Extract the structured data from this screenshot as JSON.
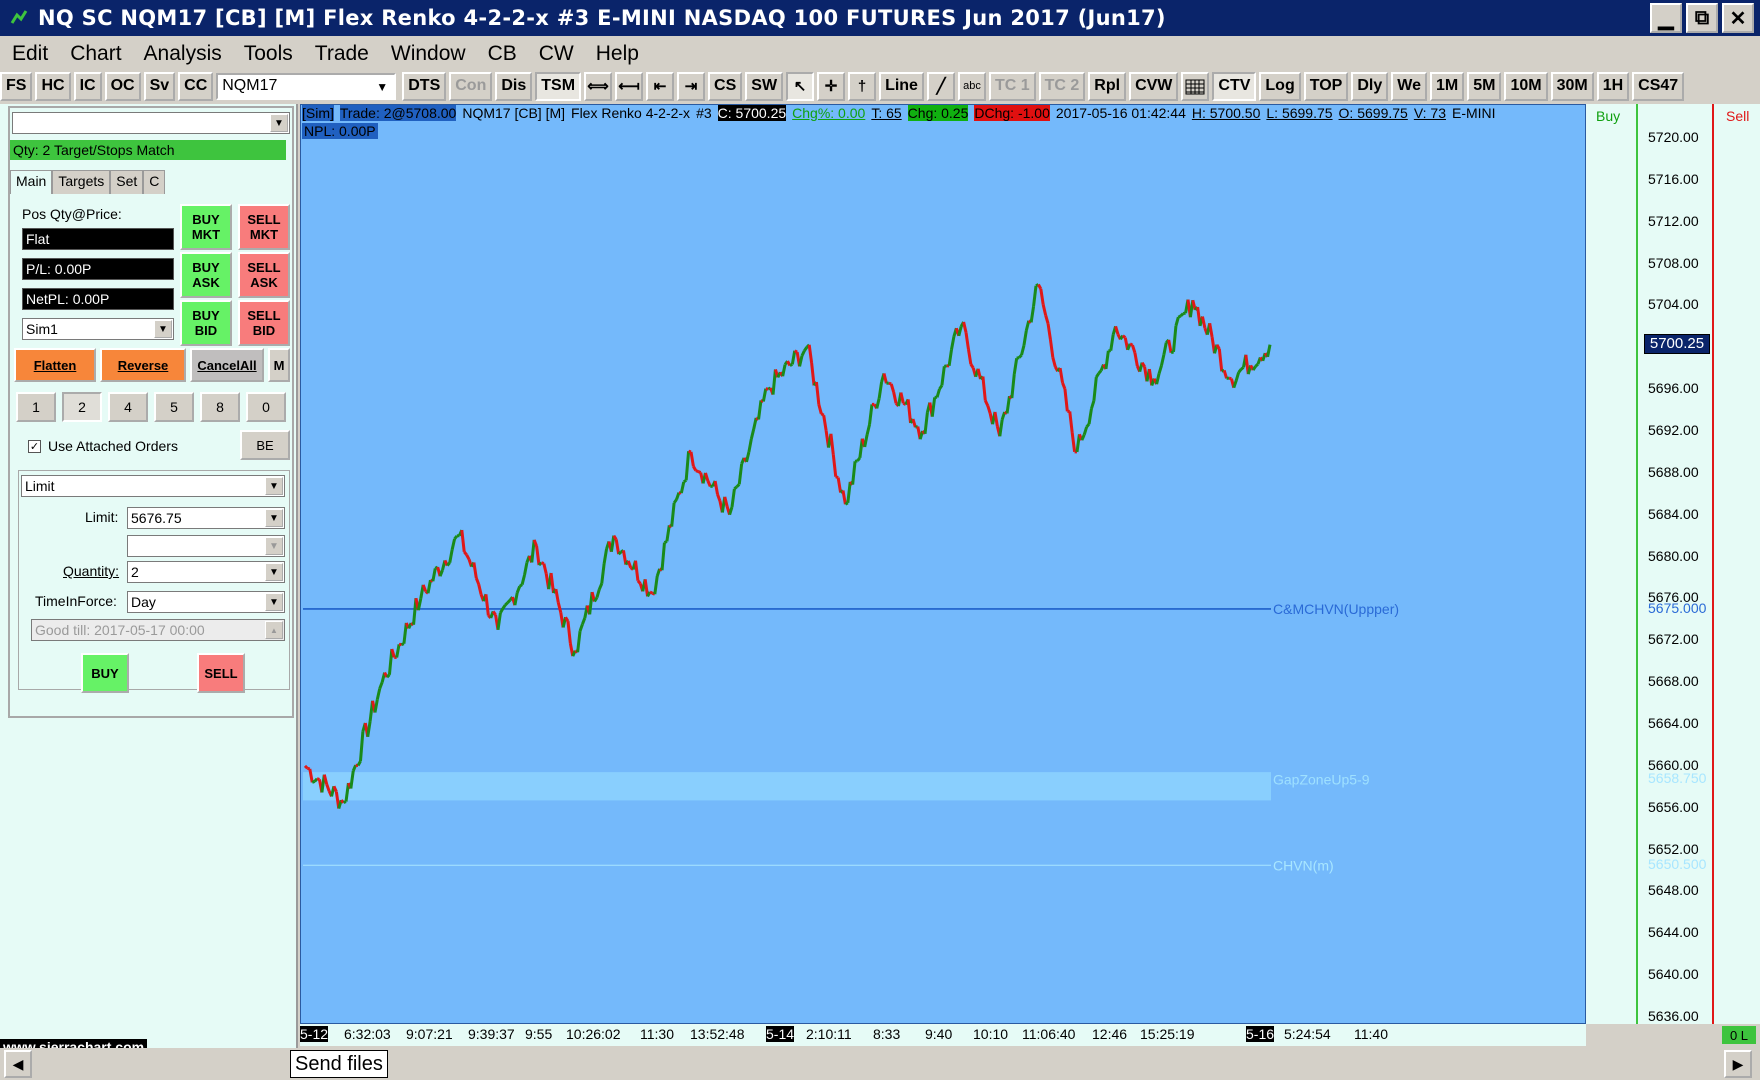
{
  "window": {
    "title": "NQ  SC NQM17 [CB] [M]  Flex Renko 4-2-2-x  #3  E-MINI NASDAQ 100 FUTURES Jun 2017 (Jun17)",
    "min_label": "▁",
    "max_label": "⧉",
    "close_label": "✕"
  },
  "menu": [
    "Edit",
    "Chart",
    "Analysis",
    "Tools",
    "Trade",
    "Window",
    "CB",
    "CW",
    "Help"
  ],
  "toolbar": {
    "left_buttons": [
      "FS",
      "HC",
      "IC",
      "OC",
      "Sv",
      "CC"
    ],
    "symbol": "NQM17",
    "buttons": [
      "DTS",
      "Con",
      "Dis",
      "TSM"
    ],
    "icon_buttons": [
      "⟺",
      "⟻",
      "⇤",
      "⇥"
    ],
    "buttons2": [
      "CS",
      "SW"
    ],
    "tool_icons": [
      "↖",
      "✛",
      "†"
    ],
    "buttons3": [
      "Line"
    ],
    "tool_icons2": [
      "╱",
      "abc"
    ],
    "buttons4": [
      "TC 1",
      "TC 2",
      "Rpl",
      "CVW"
    ],
    "buttons5": [
      "CTV",
      "Log",
      "TOP",
      "Dly",
      "We",
      "1M",
      "5M",
      "10M",
      "30M",
      "1H",
      "CS47"
    ]
  },
  "trade_panel": {
    "top_combo_value": "",
    "status": "Qty: 2 Target/Stops Match",
    "tabs": [
      "Main",
      "Targets",
      "Set",
      "C"
    ],
    "pos_label": "Pos Qty@Price:",
    "pos_value": "Flat",
    "pl_value": "P/L: 0.00P",
    "netpl_value": "NetPL: 0.00P",
    "account": "Sim1",
    "buy_mkt": "BUY MKT",
    "sell_mkt": "SELL MKT",
    "buy_ask": "BUY ASK",
    "sell_ask": "SELL ASK",
    "buy_bid": "BUY BID",
    "sell_bid": "SELL BID",
    "flatten": "Flatten",
    "reverse": "Reverse",
    "cancel_all": "CancelAll",
    "m_button": "M",
    "qty_buttons": [
      "1",
      "2",
      "4",
      "5",
      "8",
      "0"
    ],
    "use_attached": "Use Attached Orders",
    "be_button": "BE",
    "order_type": "Limit",
    "limit_label": "Limit:",
    "limit_value": "5676.75",
    "quantity_label": "Quantity:",
    "quantity_value": "2",
    "tif_label": "TimeInForce:",
    "tif_value": "Day",
    "good_till": "Good till: 2017-05-17 00:00",
    "buy": "BUY",
    "sell": "SELL"
  },
  "chart_info": {
    "sim": "[Sim]",
    "trade": "Trade: 2@5708.00",
    "symbol": "NQM17 [CB] [M]",
    "study": "Flex Renko 4-2-2-x",
    "num": "#3",
    "close": "C: 5700.25",
    "chg_pct": "Chg%: 0.00",
    "t": "T: 65",
    "chg": "Chg: 0.25",
    "dchg": "DChg: -1.00",
    "datetime": "2017-05-16 01:42:44",
    "high": "H: 5700.50",
    "low": "L: 5699.75",
    "open": "O: 5699.75",
    "volume": "V: 73",
    "name": "E-MINI",
    "npl": "NPL: 0.00P"
  },
  "buy_label": "Buy",
  "sell_label": "Sell",
  "colors": {
    "chart_bg": "#74b9fb",
    "up_bar": "#1a8a1a",
    "down_bar": "#e01818",
    "hvn_line": "#1d5fc9",
    "zone": "#8fd4ff"
  },
  "price_axis": {
    "ticks": [
      "5720.00",
      "5716.00",
      "5712.00",
      "5708.00",
      "5704.00",
      "5696.00",
      "5692.00",
      "5688.00",
      "5684.00",
      "5680.00",
      "5676.00",
      "5672.00",
      "5668.00",
      "5664.00",
      "5660.00",
      "5656.00",
      "5652.00",
      "5648.00",
      "5644.00",
      "5640.00",
      "5636.00"
    ],
    "current_price": "5700.25",
    "level_labels": [
      "5675.000",
      "5658.750",
      "5650.500"
    ]
  },
  "chart_lines": [
    {
      "label": "C&MCHVN(Uppper)",
      "price": 5675.0
    },
    {
      "label": "GapZoneUp5-9",
      "price": 5658.75
    },
    {
      "label": "CHVN(m)",
      "price": 5650.5
    }
  ],
  "time_axis": {
    "ticks": [
      {
        "label": "5-12",
        "dark": true
      },
      {
        "label": "6:32:03",
        "dark": false
      },
      {
        "label": "9:07:21",
        "dark": false
      },
      {
        "label": "9:39:37",
        "dark": false
      },
      {
        "label": "9:55",
        "dark": false
      },
      {
        "label": "10:26:02",
        "dark": false
      },
      {
        "label": "11:30",
        "dark": false
      },
      {
        "label": "13:52:48",
        "dark": false
      },
      {
        "label": "5-14",
        "dark": true
      },
      {
        "label": "2:10:11",
        "dark": false
      },
      {
        "label": "8:33",
        "dark": false
      },
      {
        "label": "9:40",
        "dark": false
      },
      {
        "label": "10:10",
        "dark": false
      },
      {
        "label": "11:06:40",
        "dark": false
      },
      {
        "label": "12:46",
        "dark": false
      },
      {
        "label": "15:25:19",
        "dark": false
      },
      {
        "label": "5-16",
        "dark": true
      },
      {
        "label": "5:24:54",
        "dark": false
      },
      {
        "label": "11:40",
        "dark": false
      }
    ]
  },
  "chart_data": {
    "type": "line",
    "title": "",
    "ylim": [
      5636,
      5722
    ],
    "series": [
      {
        "x": [
          0,
          4,
          8,
          12,
          16,
          20,
          24,
          28,
          32,
          36,
          40,
          44,
          48,
          52,
          56,
          60,
          64,
          68,
          72,
          76,
          80,
          84,
          88,
          92,
          96,
          100
        ],
        "values": [
          5660,
          5656.5,
          5668,
          5676,
          5682,
          5673,
          5681,
          5671,
          5682,
          5676.5,
          5690,
          5684,
          5696,
          5700,
          5685,
          5697.5,
          5692,
          5702,
          5691.5,
          5706,
          5690,
          5702,
          5697,
          5704.5,
          5697,
          5700.25
        ]
      }
    ]
  },
  "sc_link": "www.sierrachart.com",
  "zero_l": "0 L",
  "send_files": "Send files"
}
